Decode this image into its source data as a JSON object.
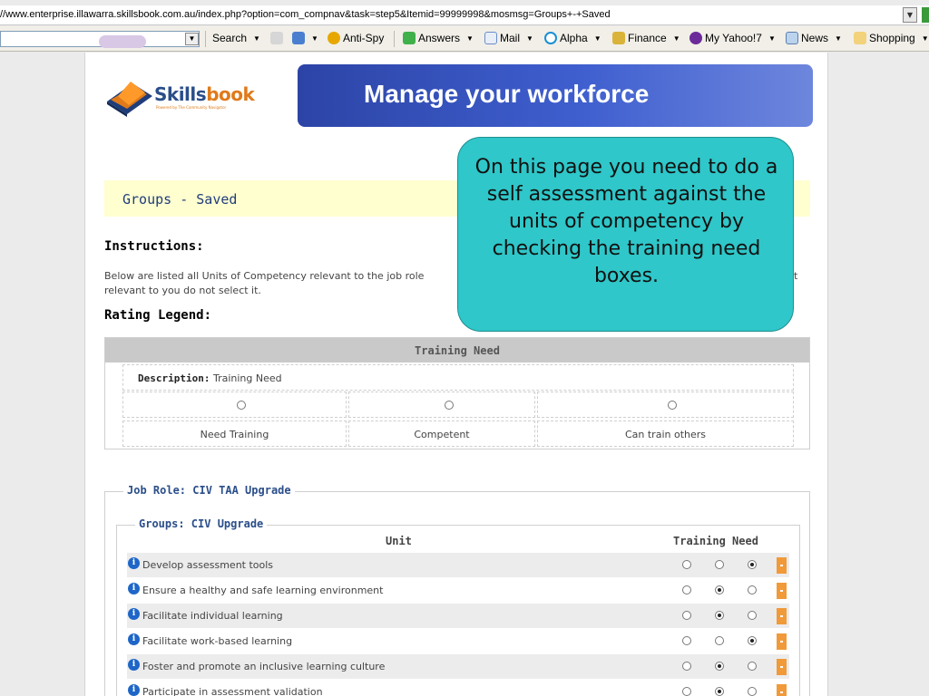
{
  "browser": {
    "address": "//www.enterprise.illawarra.skillsbook.com.au/index.php?option=com_compnav&task=step5&Itemid=99999998&mosmsg=Groups+-+Saved",
    "toolbar": {
      "search_label": "Search",
      "items": [
        "Anti-Spy",
        "Answers",
        "Mail",
        "Alpha",
        "Finance",
        "My Yahoo!7",
        "News",
        "Shopping"
      ]
    }
  },
  "logo": {
    "text_a": "Skills",
    "text_b": "book",
    "tagline": "Powered by The Community Navigator"
  },
  "banner": {
    "title": "Manage your workforce"
  },
  "saved": {
    "title": "Groups - Saved"
  },
  "instructions": {
    "heading": "Instructions:",
    "line1": "Below are listed all Units of Competency relevant to the job role",
    "line1_tail": "t",
    "line2": "relevant to you do not select it."
  },
  "legend": {
    "heading": "Rating Legend:",
    "header": "Training Need",
    "description_label": "Description:",
    "description_value": "Training Need",
    "options": [
      "Need Training",
      "Competent",
      "Can train others"
    ]
  },
  "job_role": {
    "title": "Job Role: CIV TAA Upgrade",
    "group_title": "Groups: CIV Upgrade",
    "col_unit": "Unit",
    "col_need": "Training Need",
    "units": [
      {
        "name": "Develop assessment tools",
        "selected": 2
      },
      {
        "name": "Ensure a healthy and safe learning environment",
        "selected": 1
      },
      {
        "name": "Facilitate individual learning",
        "selected": 1
      },
      {
        "name": "Facilitate work-based learning",
        "selected": 2
      },
      {
        "name": "Foster and promote an inclusive learning culture",
        "selected": 1
      },
      {
        "name": "Participate in assessment validation",
        "selected": 1
      }
    ]
  },
  "callout": {
    "text": "On this page you need to do a self assessment against the units of competency by checking the training need boxes.",
    "color": "#2fc7c9"
  },
  "colors": {
    "banner": "#2c44a6",
    "saved_bg": "#ffffd0",
    "orange": "#f09a3a",
    "link_blue": "#2a4e8a"
  }
}
